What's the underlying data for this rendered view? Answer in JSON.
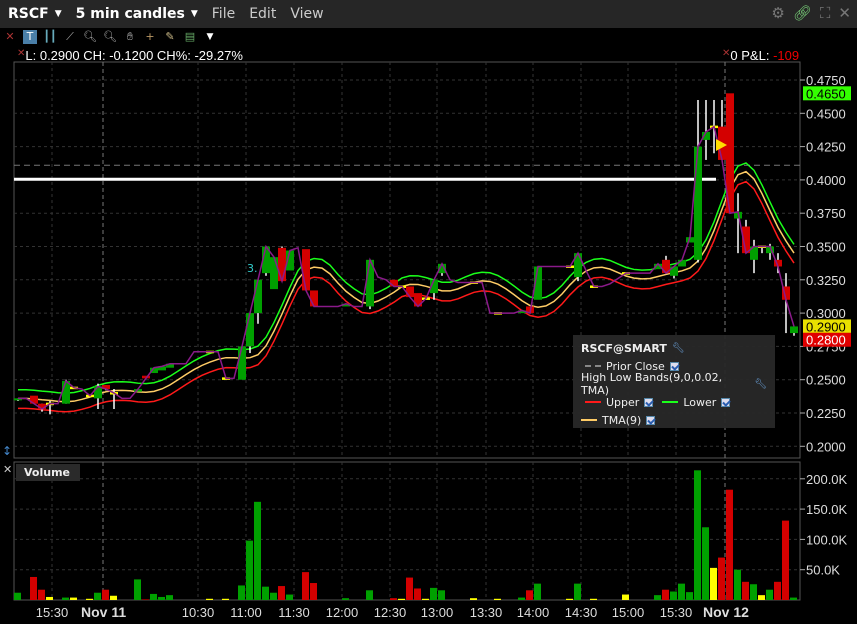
{
  "titlebar": {
    "symbol": "RSCF",
    "interval": "5 min candles",
    "menu": [
      "File",
      "Edit",
      "View"
    ]
  },
  "toolbar": {
    "icons": [
      "close-icon",
      "text-icon",
      "bars-icon",
      "trendline-icon",
      "zoom-in-icon",
      "zoom-out-icon",
      "hand-icon",
      "crosshair-icon",
      "eraser-icon",
      "studies-icon",
      "dropdown-icon"
    ]
  },
  "info": {
    "text": "L: 0.2900 CH: -0.1200 CH%: -29.27%"
  },
  "pnl": {
    "position": "0",
    "label": "P&L:",
    "value": "-109"
  },
  "annotation": "3.",
  "legend": {
    "title": "RSCF@SMART",
    "prior_close": "Prior Close",
    "study": "High Low Bands(9,0,0.02, TMA)",
    "upper": "Upper",
    "lower": "Lower",
    "tma": "TMA(9)",
    "colors": {
      "upper": "#ff1a1a",
      "lower": "#1aff1a",
      "tma": "#ffcc66",
      "prior_close": "#888888"
    }
  },
  "volume_panel": {
    "title": "Volume"
  },
  "colors": {
    "up": "#00a000",
    "down": "#d40000",
    "unchanged": "#ffff00",
    "last_price_bg": "#33ff00",
    "bid_bg": "#e8e000",
    "ask_bg": "#e00000"
  },
  "chart_data": [
    {
      "type": "candlestick",
      "ylim": [
        0.2,
        0.4875
      ],
      "y_ticks": [
        "0.2000",
        "0.2250",
        "0.2500",
        "0.2750",
        "0.3000",
        "0.3250",
        "0.3500",
        "0.3750",
        "0.4000",
        "0.4250",
        "0.4500",
        "0.4750"
      ],
      "x_tick_labels": [
        "15:30",
        "Nov 11",
        "10:30",
        "11:00",
        "11:30",
        "12:00",
        "12:30",
        "13:00",
        "13:30",
        "14:00",
        "14:30",
        "15:00",
        "15:30",
        "Nov 12"
      ],
      "price_labels": {
        "high": "0.4650",
        "bid": "0.2900",
        "ask": "0.2800"
      },
      "prior_close": 0.411,
      "horizontal_line": 0.4005,
      "ohlc": [
        [
          0.235,
          0.236,
          0.234,
          0.236
        ],
        [
          0.236,
          0.236,
          0.236,
          0.236
        ],
        [
          0.238,
          0.238,
          0.232,
          0.232
        ],
        [
          0.232,
          0.232,
          0.226,
          0.228
        ],
        [
          0.232,
          0.234,
          0.224,
          0.232
        ],
        [
          0.232,
          0.232,
          0.232,
          0.232
        ],
        [
          0.232,
          0.25,
          0.232,
          0.249
        ],
        [
          0.244,
          0.244,
          0.244,
          0.244
        ],
        [
          0.243,
          0.243,
          0.243,
          0.243
        ],
        [
          0.238,
          0.238,
          0.238,
          0.238
        ],
        [
          0.236,
          0.247,
          0.228,
          0.245
        ],
        [
          0.246,
          0.246,
          0.242,
          0.243
        ],
        [
          0.24,
          0.243,
          0.228,
          0.24
        ],
        [
          0.236,
          0.236,
          0.236,
          0.236
        ],
        [
          0.236,
          0.236,
          0.236,
          0.236
        ],
        [
          0.241,
          0.243,
          0.241,
          0.243
        ],
        [
          0.253,
          0.253,
          0.251,
          0.251
        ],
        [
          0.255,
          0.259,
          0.255,
          0.259
        ],
        [
          0.257,
          0.26,
          0.257,
          0.26
        ],
        [
          0.259,
          0.262,
          0.259,
          0.262
        ],
        [
          0.262,
          0.262,
          0.262,
          0.262
        ],
        [
          0.262,
          0.262,
          0.262,
          0.262
        ],
        [
          0.271,
          0.271,
          0.271,
          0.271
        ],
        [
          0.271,
          0.271,
          0.271,
          0.271
        ],
        [
          0.271,
          0.271,
          0.271,
          0.271
        ],
        [
          0.271,
          0.271,
          0.271,
          0.271
        ],
        [
          0.251,
          0.251,
          0.251,
          0.251
        ],
        [
          0.251,
          0.251,
          0.251,
          0.251
        ],
        [
          0.25,
          0.275,
          0.25,
          0.275
        ],
        [
          0.275,
          0.3,
          0.27,
          0.3
        ],
        [
          0.3,
          0.325,
          0.292,
          0.325
        ],
        [
          0.33,
          0.35,
          0.328,
          0.35
        ],
        [
          0.318,
          0.342,
          0.318,
          0.342
        ],
        [
          0.349,
          0.35,
          0.324,
          0.324
        ],
        [
          0.332,
          0.347,
          0.332,
          0.347
        ],
        [
          0.349,
          0.349,
          0.349,
          0.349
        ],
        [
          0.348,
          0.348,
          0.317,
          0.317
        ],
        [
          0.317,
          0.317,
          0.305,
          0.305
        ],
        [
          0.305,
          0.305,
          0.305,
          0.305
        ],
        [
          0.305,
          0.305,
          0.305,
          0.305
        ],
        [
          0.305,
          0.305,
          0.305,
          0.305
        ],
        [
          0.305,
          0.307,
          0.305,
          0.307
        ],
        [
          0.305,
          0.305,
          0.305,
          0.305
        ],
        [
          0.305,
          0.305,
          0.305,
          0.305
        ],
        [
          0.305,
          0.34,
          0.303,
          0.34
        ],
        [
          0.327,
          0.327,
          0.327,
          0.327
        ],
        [
          0.325,
          0.325,
          0.325,
          0.325
        ],
        [
          0.325,
          0.325,
          0.32,
          0.32
        ],
        [
          0.32,
          0.32,
          0.32,
          0.32
        ],
        [
          0.32,
          0.32,
          0.312,
          0.312
        ],
        [
          0.315,
          0.315,
          0.305,
          0.305
        ],
        [
          0.311,
          0.311,
          0.311,
          0.311
        ],
        [
          0.315,
          0.325,
          0.31,
          0.325
        ],
        [
          0.33,
          0.337,
          0.328,
          0.337
        ],
        [
          0.325,
          0.325,
          0.325,
          0.325
        ],
        [
          0.323,
          0.323,
          0.323,
          0.323
        ],
        [
          0.323,
          0.323,
          0.323,
          0.323
        ],
        [
          0.323,
          0.323,
          0.323,
          0.323
        ],
        [
          0.323,
          0.323,
          0.323,
          0.323
        ],
        [
          0.3,
          0.3,
          0.3,
          0.3
        ],
        [
          0.3,
          0.3,
          0.3,
          0.3
        ],
        [
          0.3,
          0.3,
          0.3,
          0.3
        ],
        [
          0.3,
          0.3,
          0.3,
          0.3
        ],
        [
          0.3,
          0.302,
          0.3,
          0.302
        ],
        [
          0.305,
          0.305,
          0.3,
          0.3
        ],
        [
          0.31,
          0.335,
          0.31,
          0.335
        ],
        [
          0.335,
          0.335,
          0.335,
          0.335
        ],
        [
          0.335,
          0.335,
          0.335,
          0.335
        ],
        [
          0.335,
          0.335,
          0.335,
          0.335
        ],
        [
          0.335,
          0.335,
          0.335,
          0.335
        ],
        [
          0.327,
          0.345,
          0.324,
          0.345
        ],
        [
          0.332,
          0.332,
          0.332,
          0.332
        ],
        [
          0.32,
          0.32,
          0.32,
          0.32
        ],
        [
          0.32,
          0.32,
          0.32,
          0.32
        ],
        [
          0.322,
          0.322,
          0.322,
          0.322
        ],
        [
          0.326,
          0.326,
          0.326,
          0.326
        ],
        [
          0.33,
          0.33,
          0.33,
          0.33
        ],
        [
          0.33,
          0.33,
          0.33,
          0.33
        ],
        [
          0.33,
          0.33,
          0.33,
          0.33
        ],
        [
          0.33,
          0.33,
          0.33,
          0.33
        ],
        [
          0.333,
          0.337,
          0.333,
          0.337
        ],
        [
          0.34,
          0.343,
          0.33,
          0.33
        ],
        [
          0.328,
          0.335,
          0.326,
          0.335
        ],
        [
          0.335,
          0.34,
          0.335,
          0.34
        ],
        [
          0.353,
          0.357,
          0.353,
          0.357
        ],
        [
          0.34,
          0.46,
          0.338,
          0.425
        ],
        [
          0.43,
          0.46,
          0.415,
          0.436
        ],
        [
          0.44,
          0.46,
          0.42,
          0.44
        ],
        [
          0.44,
          0.46,
          0.415,
          0.415
        ],
        [
          0.465,
          0.465,
          0.375,
          0.375
        ],
        [
          0.371,
          0.39,
          0.345,
          0.376
        ],
        [
          0.365,
          0.37,
          0.345,
          0.345
        ],
        [
          0.34,
          0.355,
          0.33,
          0.35
        ],
        [
          0.35,
          0.35,
          0.345,
          0.35
        ],
        [
          0.345,
          0.352,
          0.34,
          0.35
        ],
        [
          0.34,
          0.345,
          0.33,
          0.335
        ],
        [
          0.32,
          0.33,
          0.285,
          0.31
        ],
        [
          0.285,
          0.29,
          0.283,
          0.29
        ]
      ]
    },
    {
      "type": "bar",
      "title": "Volume",
      "y_ticks": [
        "50.0K",
        "100.0K",
        "150.0K",
        "200.0K"
      ],
      "ylim": [
        0,
        220000
      ],
      "values_k": [
        12,
        0,
        38,
        17,
        5,
        0,
        4,
        4,
        0,
        2,
        12,
        17,
        7,
        0,
        0,
        34,
        1,
        10,
        5,
        8,
        0,
        0,
        0,
        0,
        2,
        0,
        2,
        0,
        24,
        98,
        162,
        22,
        12,
        23,
        9,
        0,
        46,
        28,
        0,
        0,
        0,
        3,
        0,
        0,
        16,
        0,
        0,
        3,
        2,
        37,
        19,
        2,
        20,
        16,
        0,
        0,
        0,
        3,
        0,
        0,
        2,
        0,
        0,
        4,
        16,
        27,
        0,
        0,
        0,
        2,
        27,
        0,
        2,
        0,
        0,
        0,
        9,
        0,
        0,
        0,
        8,
        17,
        14,
        27,
        13,
        214,
        120,
        53,
        70,
        182,
        50,
        30,
        26,
        8,
        17,
        30,
        131,
        4
      ]
    }
  ]
}
